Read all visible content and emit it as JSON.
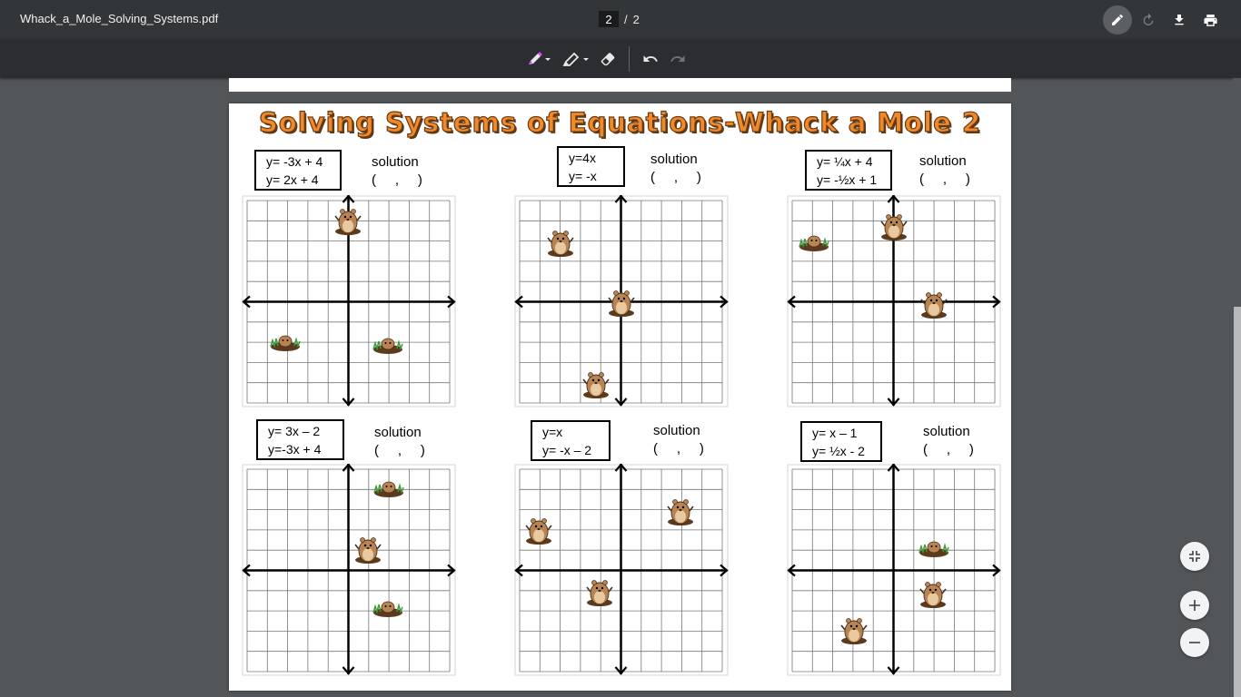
{
  "header": {
    "file_name": "Whack_a_Mole_Solving_Systems.pdf",
    "current_page": "2",
    "separator": "/",
    "total_pages": "2"
  },
  "toolbar_icons": {
    "annotate": "pen-icon",
    "rotate": "rotate-icon",
    "download": "download-icon",
    "print": "print-icon",
    "pen_tool": "marker-icon",
    "highlighter_tool": "highlighter-icon",
    "eraser_tool": "eraser-icon",
    "undo": "undo-icon",
    "redo": "redo-icon",
    "fit": "fit-to-page-icon",
    "zoom_in": "plus-icon",
    "zoom_out": "minus-icon"
  },
  "colors": {
    "pen_color": "#e040fb",
    "title_color": "#f0892a",
    "mole_body": "#b88454"
  },
  "worksheet": {
    "title": "Solving Systems of Equations-Whack a Mole 2",
    "solution_label": "solution",
    "solution_blank": "(     ,     )",
    "problems": [
      {
        "eq1": "y= -3x + 4",
        "eq2": "y= 2x + 4"
      },
      {
        "eq1": "y=4x",
        "eq2": "y= -x"
      },
      {
        "eq1": "y= ¼x + 4",
        "eq2": "y= -½x + 1"
      },
      {
        "eq1": "y= 3x – 2",
        "eq2": "y=-3x + 4"
      },
      {
        "eq1": "y=x",
        "eq2": "y= -x – 2"
      },
      {
        "eq1": "y= x – 1",
        "eq2": "y= ½x - 2"
      }
    ]
  }
}
